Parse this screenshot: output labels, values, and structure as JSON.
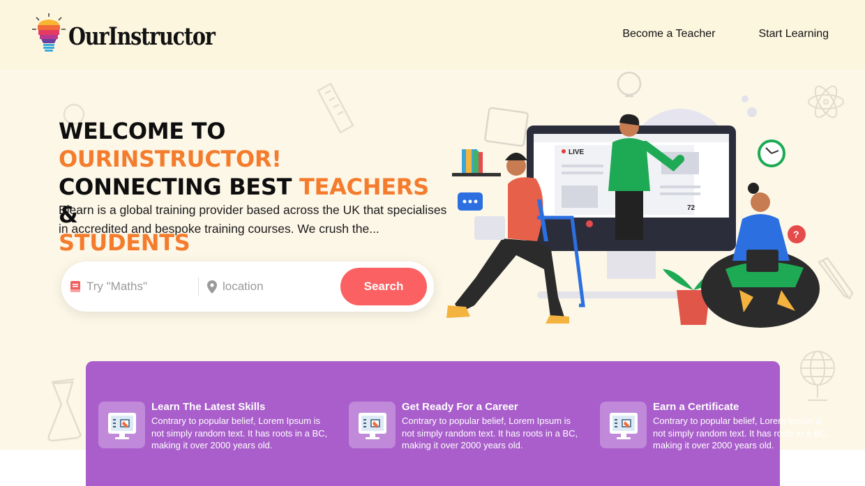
{
  "brand": {
    "name": "OurInstructor"
  },
  "nav": {
    "items": [
      "Become a Teacher",
      "Start Learning"
    ]
  },
  "hero": {
    "headline_line1_a": "WELCOME TO ",
    "headline_line1_b": "OURINSTRUCTOR!",
    "headline_line2_a": "CONNECTING BEST ",
    "headline_line2_b": "TEACHERS",
    "headline_line2_c": " &",
    "headline_line3": "STUDENTS",
    "intro": "Elearn is a global training provider based across the UK that specialises in accredited and bespoke training courses. We crush the..."
  },
  "search": {
    "subject_placeholder": "Try \"Maths\"",
    "location_placeholder": "location",
    "button_label": "Search"
  },
  "illustration": {
    "live_label": "LIVE",
    "viewers": "72"
  },
  "colors": {
    "accent_orange": "#f47c2c",
    "search_button": "#fb6162",
    "features_bg": "#a95ecb",
    "hero_bg": "#fdf7e8"
  },
  "features": [
    {
      "title": "Learn The Latest Skills",
      "description": "Contrary to popular belief, Lorem Ipsum is not simply random text. It has roots in a BC, making it over 2000 years old.",
      "icon": "online-lesson-icon"
    },
    {
      "title": "Get Ready For a Career",
      "description": "Contrary to popular belief, Lorem Ipsum is not simply random text. It has roots in a BC, making it over 2000 years old.",
      "icon": "online-lesson-icon"
    },
    {
      "title": "Earn a Certificate",
      "description": "Contrary to popular belief, Lorem Ipsum is not simply random text. It has roots in a BC, making it over 2000 years old.",
      "icon": "online-lesson-icon"
    }
  ]
}
